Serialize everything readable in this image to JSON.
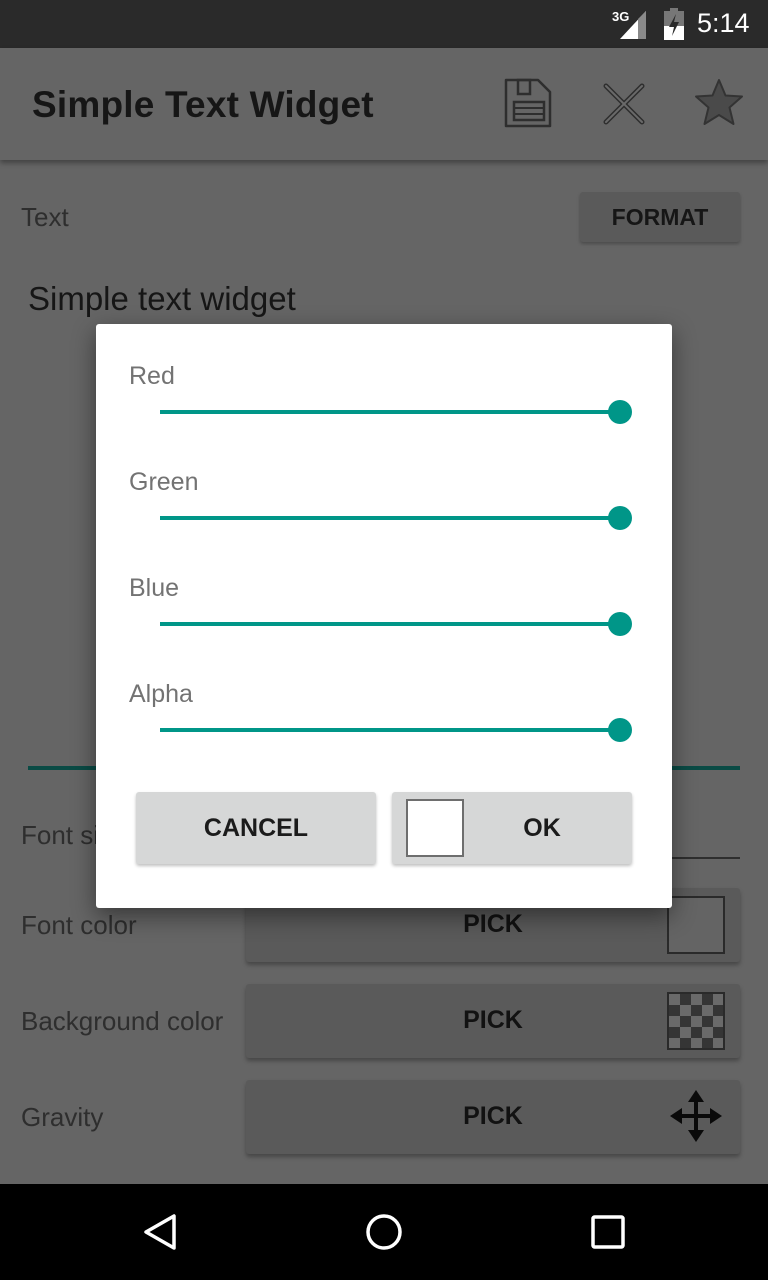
{
  "status_bar": {
    "network": "3G",
    "time": "5:14",
    "icons": [
      "signal-icon",
      "battery-charging-icon"
    ]
  },
  "app_bar": {
    "title": "Simple Text Widget",
    "actions": [
      {
        "name": "save",
        "icon": "floppy-disk-icon"
      },
      {
        "name": "close",
        "icon": "close-icon"
      },
      {
        "name": "favorite",
        "icon": "star-icon"
      }
    ]
  },
  "content": {
    "text_label": "Text",
    "format_button": "FORMAT",
    "text_value": "Simple text widget",
    "font_size_label": "Font size",
    "font_color_label": "Font color",
    "background_color_label": "Background color",
    "gravity_label": "Gravity",
    "pick_label": "PICK",
    "font_color_swatch": "#ffffff",
    "background_color_swatch": "transparent"
  },
  "dialog": {
    "channels": [
      {
        "label": "Red",
        "value": 255,
        "max": 255
      },
      {
        "label": "Green",
        "value": 255,
        "max": 255
      },
      {
        "label": "Blue",
        "value": 255,
        "max": 255
      },
      {
        "label": "Alpha",
        "value": 255,
        "max": 255
      }
    ],
    "cancel_label": "CANCEL",
    "ok_label": "OK",
    "preview_color": "#ffffff",
    "accent_color": "#009688"
  },
  "nav_bar": {
    "buttons": [
      "back",
      "home",
      "recents"
    ]
  }
}
